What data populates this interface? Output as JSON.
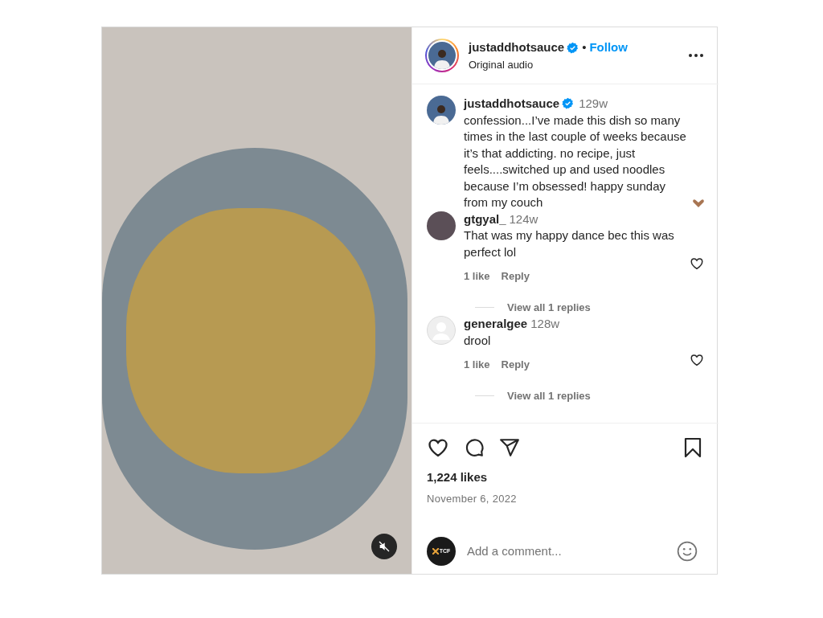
{
  "post": {
    "author": "justaddhotsauce",
    "verified": true,
    "separator": "•",
    "follow": "Follow",
    "audio": "Original audio",
    "muted": true
  },
  "caption": {
    "author": "justaddhotsauce",
    "verified": true,
    "age": "129w",
    "text": "confession...I’ve made this dish so many times in the last couple of weeks because it’s that addicting. no recipe, just feels....switched up and used noodles because I’m obsessed! happy sunday from my couch"
  },
  "comments": [
    {
      "author": "gtgyal_",
      "age": "124w",
      "text": "That was my happy dance bec this was perfect lol",
      "likes": "1 like",
      "reply": "Reply",
      "view_replies": "View all 1 replies",
      "kind": "photo",
      "liked": false
    },
    {
      "author": "generalgee",
      "age": "128w",
      "text": "drool",
      "likes": "1 like",
      "reply": "Reply",
      "view_replies": "View all 1 replies",
      "kind": "default",
      "liked": false
    }
  ],
  "actions": {
    "liked": false,
    "saved": false,
    "likes": "1,224 likes",
    "date": "November 6, 2022"
  },
  "add_comment": {
    "avatar_text": "TCF",
    "placeholder": "Add a comment..."
  }
}
